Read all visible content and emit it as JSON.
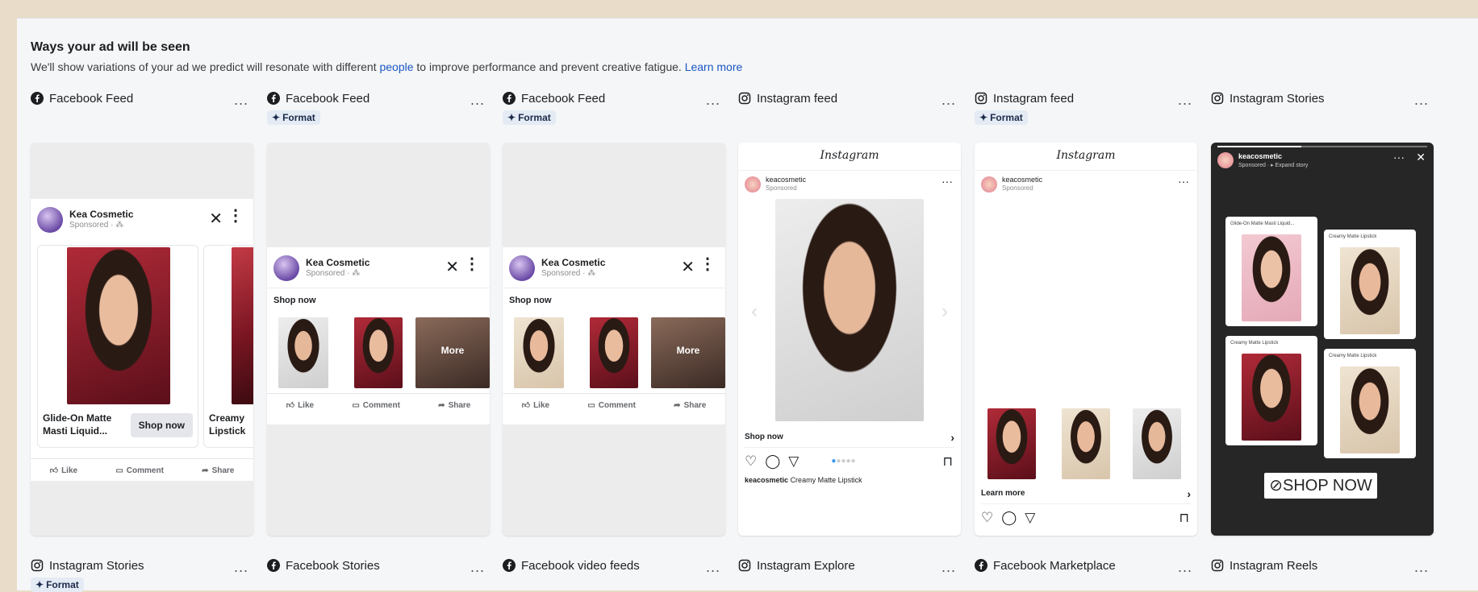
{
  "header": {
    "title": "Ways your ad will be seen",
    "desc_before": "We'll show variations of your ad we predict will resonate with different ",
    "desc_link1": "people",
    "desc_middle": " to improve performance and prevent creative fatigue. ",
    "desc_link2": "Learn more"
  },
  "more_glyph": "...",
  "placements_top": [
    {
      "platform": "Facebook Feed",
      "icon": "facebook-icon",
      "badge": ""
    },
    {
      "platform": "Facebook Feed",
      "icon": "facebook-icon",
      "badge": "Format"
    },
    {
      "platform": "Facebook Feed",
      "icon": "facebook-icon",
      "badge": "Format"
    },
    {
      "platform": "Instagram feed",
      "icon": "instagram-icon",
      "badge": ""
    },
    {
      "platform": "Instagram feed",
      "icon": "instagram-icon",
      "badge": "Format"
    },
    {
      "platform": "Instagram Stories",
      "icon": "instagram-icon",
      "badge": ""
    }
  ],
  "placements_bottom": [
    {
      "platform": "Instagram Stories",
      "icon": "instagram-icon",
      "badge": "Format"
    },
    {
      "platform": "Facebook Stories",
      "icon": "facebook-icon",
      "badge": ""
    },
    {
      "platform": "Facebook video feeds",
      "icon": "facebook-icon",
      "badge": ""
    },
    {
      "platform": "Instagram Explore",
      "icon": "instagram-icon",
      "badge": ""
    },
    {
      "platform": "Facebook Marketplace",
      "icon": "facebook-icon",
      "badge": ""
    },
    {
      "platform": "Instagram Reels",
      "icon": "instagram-icon",
      "badge": ""
    }
  ],
  "fb_ad": {
    "account": "Kea Cosmetic",
    "sponsored": "Sponsored · ⁂",
    "shop_now": "Shop now",
    "more": "More",
    "like": "Like",
    "comment": "Comment",
    "share": "Share",
    "carousel_item1_title": "Glide-On Matte Masti Liquid...",
    "carousel_item1_cta": "Shop now",
    "carousel_item2_title": "Creamy Lipstick"
  },
  "ig_ad": {
    "logo": "Instagram",
    "account": "keacosmetic",
    "sponsored": "Sponsored",
    "shop_now": "Shop now",
    "caption_account": "keacosmetic",
    "caption_text": "Creamy Matte Lipstick",
    "learn_more": "Learn more"
  },
  "story_ad": {
    "account": "keacosmetic",
    "sponsored": "Sponsored · ▸ Expand story",
    "label1": "Glide-On Matte Masti Liquid...",
    "label2": "Creamy Matte Lipstick",
    "label3": "Creamy Matte Lipstick",
    "label4": "Creamy Matte Lipstick",
    "cta": "SHOP NOW"
  }
}
